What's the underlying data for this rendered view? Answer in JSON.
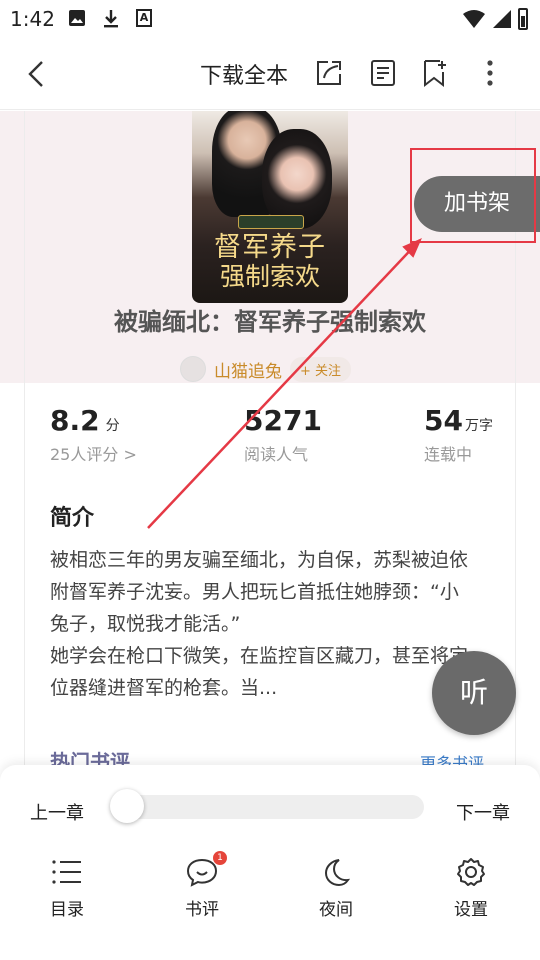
{
  "status_bar": {
    "time": "1:42",
    "a_icon_letter": "A"
  },
  "header": {
    "download_all": "下载全本"
  },
  "book": {
    "cover_title_line1": "督军养子",
    "cover_title_line2": "强制索欢",
    "title": "被骗缅北：督军养子强制索欢",
    "author": "山猫追兔",
    "follow_label": "+ 关注"
  },
  "shelf_button": "加书架",
  "stats": {
    "rating": {
      "value": "8.2",
      "unit": "分",
      "label": "25人评分 >"
    },
    "popularity": {
      "value": "5271",
      "label": "阅读人气"
    },
    "words": {
      "value": "54",
      "unit": "万字",
      "label": "连载中"
    }
  },
  "intro": {
    "heading": "简介",
    "text": "被相恋三年的男友骗至缅北，为自保，苏梨被迫依附督军养子沈妄。男人把玩匕首抵住她脖颈：“小兔子，取悦我才能活。”\n她学会在枪口下微笑，在监控盲区藏刀，甚至将定位器缝进督军的枪套。当..."
  },
  "reviews": {
    "hot_label": "热门书评",
    "more_label": "更多书评"
  },
  "listen_label": "听",
  "reader_controls": {
    "prev_chapter": "上一章",
    "next_chapter": "下一章",
    "progress": 0.0,
    "tools": [
      {
        "label": "目录",
        "icon": "list-icon"
      },
      {
        "label": "书评",
        "icon": "comment-icon",
        "badge": "1"
      },
      {
        "label": "夜间",
        "icon": "moon-icon"
      },
      {
        "label": "设置",
        "icon": "gear-icon"
      }
    ]
  },
  "colors": {
    "accent_red": "#e53945",
    "author_gold": "#c98b2a",
    "hero_bg": "#f7eff1"
  }
}
